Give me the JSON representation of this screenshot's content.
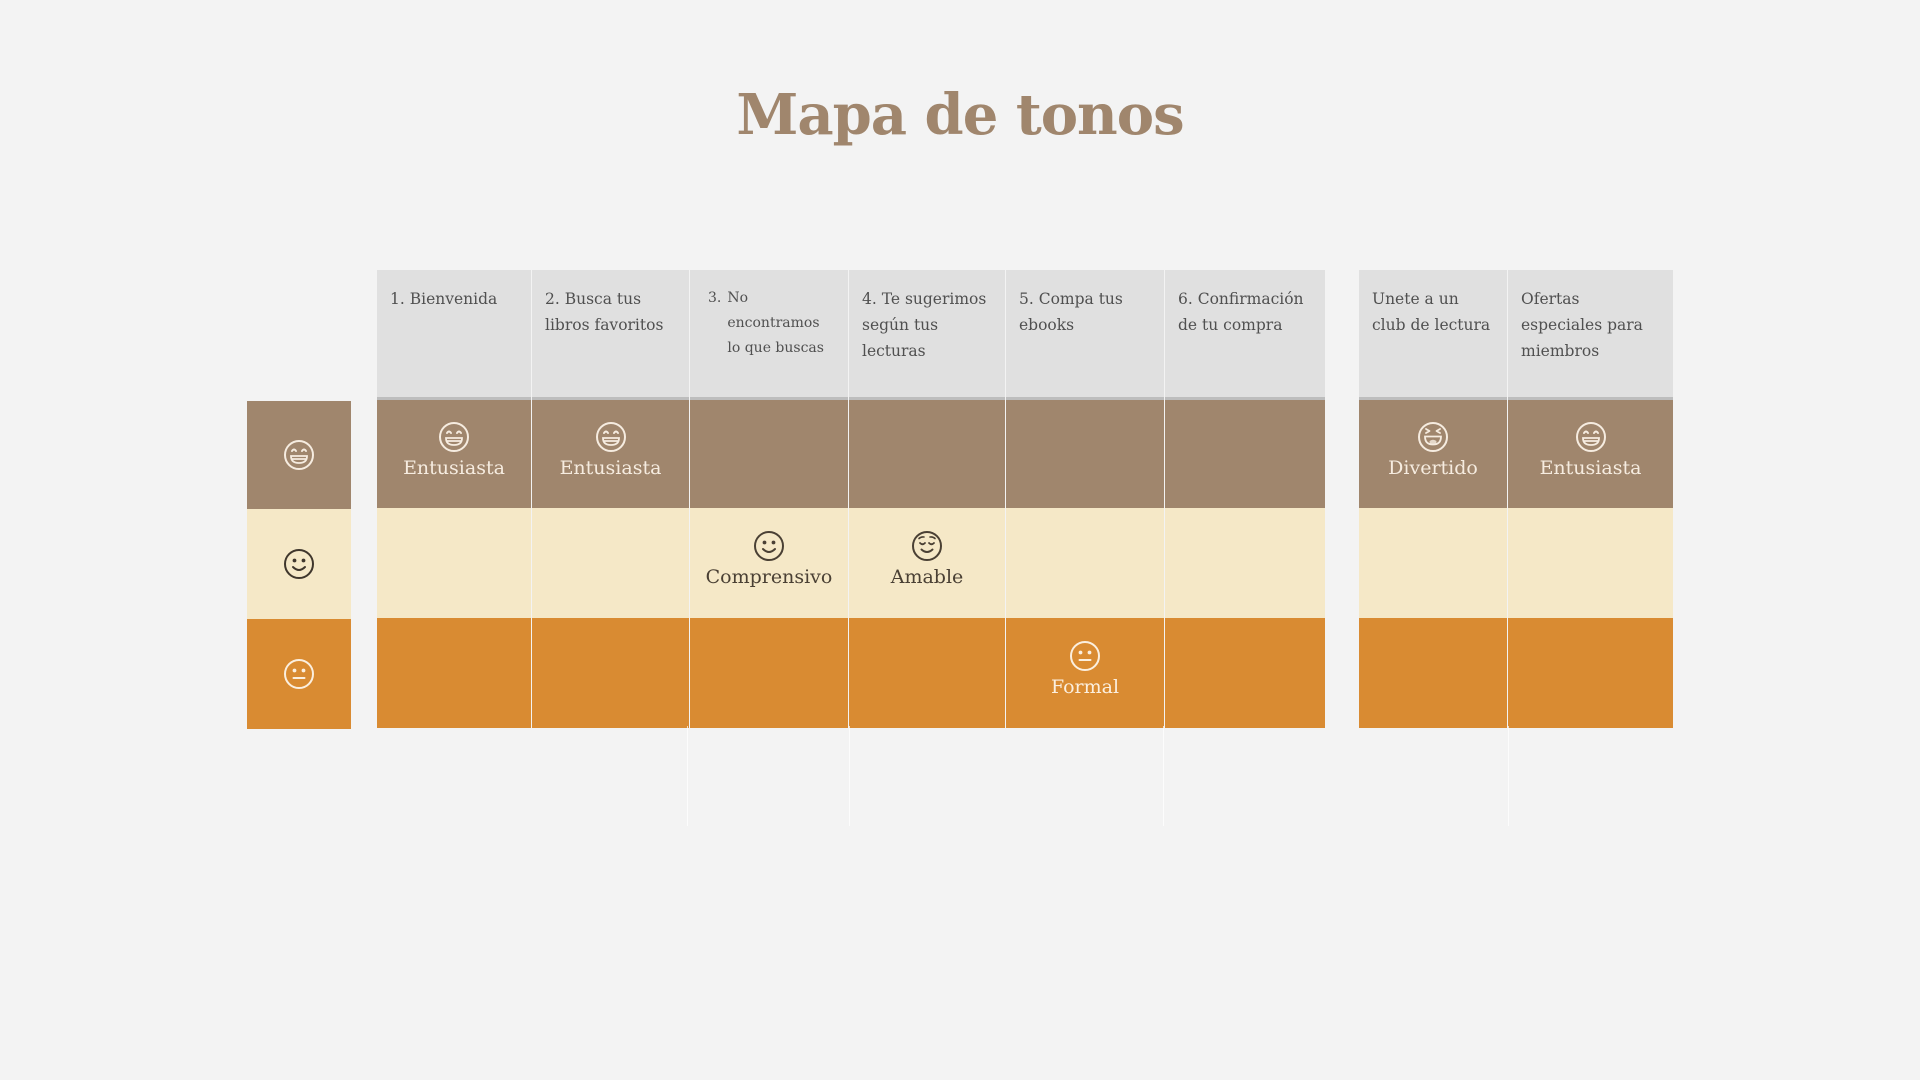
{
  "title": "Mapa de tonos",
  "colors": {
    "enthusiastic_row": "#a0866d",
    "friendly_row": "#f5e8c7",
    "formal_row": "#d98b32",
    "header": "#e0e0e0",
    "title": "#a0866d"
  },
  "tone_rows": [
    {
      "icon": "grinning-face-icon"
    },
    {
      "icon": "smiling-face-icon"
    },
    {
      "icon": "neutral-face-icon"
    }
  ],
  "groups": [
    {
      "columns": [
        {
          "header": "1. Bienvenida",
          "tone_row": 0,
          "tone": "Entusiasta",
          "icon": "grinning-face-icon"
        },
        {
          "header": "2. Busca tus libros favoritos",
          "tone_row": 0,
          "tone": "Entusiasta",
          "icon": "grinning-face-icon"
        },
        {
          "header_num": "3.",
          "header": "No encontramos lo que buscas",
          "tone_row": 1,
          "tone": "Comprensivo",
          "icon": "smiling-face-icon"
        },
        {
          "header": "4. Te sugerimos según tus lecturas",
          "tone_row": 1,
          "tone": "Amable",
          "icon": "relieved-face-icon"
        },
        {
          "header": "5. Compa tus ebooks",
          "tone_row": 2,
          "tone": "Formal",
          "icon": "neutral-face-icon"
        },
        {
          "header": "6. Confirmación de tu compra",
          "tone_row": null,
          "tone": "",
          "icon": ""
        }
      ]
    },
    {
      "columns": [
        {
          "header": "Unete a un club de lectura",
          "tone_row": 0,
          "tone": "Divertido",
          "icon": "tongue-face-icon"
        },
        {
          "header": "Ofertas especiales para miembros",
          "tone_row": 0,
          "tone": "Entusiasta",
          "icon": "grinning-face-icon"
        }
      ]
    }
  ]
}
